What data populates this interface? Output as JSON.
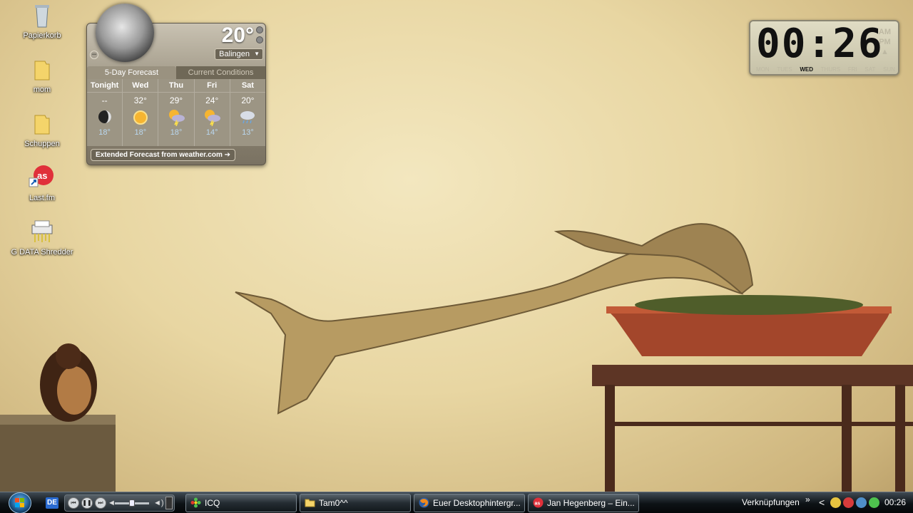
{
  "desktop_icons": [
    {
      "label": "Papierkorb",
      "icon": "recycle-bin-icon"
    },
    {
      "label": "mom",
      "icon": "folder-icon"
    },
    {
      "label": "Schuppen",
      "icon": "folder-icon"
    },
    {
      "label": "Last.fm",
      "icon": "lastfm-icon"
    },
    {
      "label": "G DATA Shredder",
      "icon": "shredder-icon"
    }
  ],
  "weather": {
    "current_temp": "20°",
    "city": "Balingen",
    "tabs": [
      "5-Day Forecast",
      "Current Conditions"
    ],
    "forecast": [
      {
        "day": "Tonight",
        "high": "--",
        "low": "18°",
        "icon": "night-moon-icon"
      },
      {
        "day": "Wed",
        "high": "32°",
        "low": "18°",
        "icon": "sunny-icon"
      },
      {
        "day": "Thu",
        "high": "29°",
        "low": "18°",
        "icon": "thunderstorm-icon"
      },
      {
        "day": "Fri",
        "high": "24°",
        "low": "14°",
        "icon": "thunderstorm-icon"
      },
      {
        "day": "Sat",
        "high": "20°",
        "low": "13°",
        "icon": "rain-icon"
      }
    ],
    "extended_link": "Extended Forecast from weather.com ➔"
  },
  "clock": {
    "time": "00:26",
    "am": "AM",
    "pm": "PM",
    "days": [
      "MON",
      "TUES",
      "WED",
      "THURS",
      "FRI",
      "SAT",
      "SUN"
    ],
    "active_day": "WED"
  },
  "taskbar": {
    "lang": "DE",
    "tasks": [
      {
        "label": "ICQ",
        "icon": "icq-flower-icon"
      },
      {
        "label": "Tam0^^",
        "icon": "folder-icon"
      },
      {
        "label": "Euer Desktophintergr...",
        "icon": "firefox-icon"
      },
      {
        "label": "Jan Hegenberg – Ein...",
        "icon": "lastfm-icon"
      }
    ],
    "links": "Verknüpfungen",
    "chevron": "»",
    "arrow": "<",
    "time": "00:26",
    "colors": {
      "accent": "#2a6bd1"
    }
  }
}
